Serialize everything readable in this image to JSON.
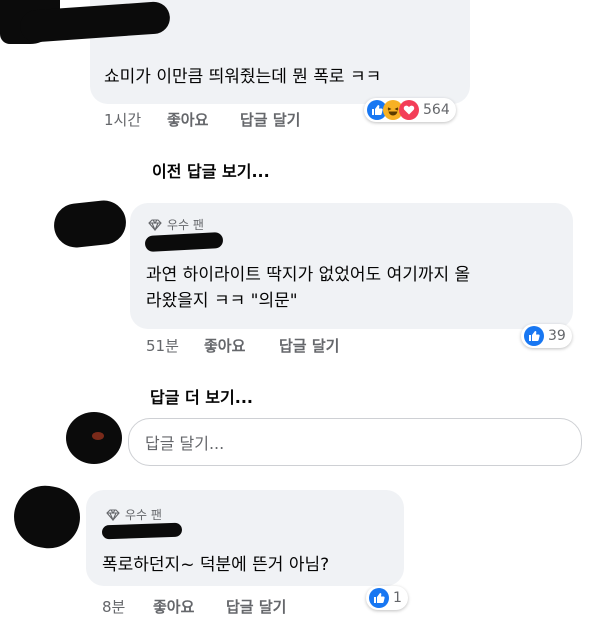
{
  "comments": [
    {
      "text": "쇼미가 이만큼 띄워줬는데 뭔 폭로 ㅋㅋ",
      "time": "1시간",
      "like_label": "좋아요",
      "reply_label": "답글 달기",
      "reaction_count": "564",
      "reactions": [
        "like-icon",
        "haha-icon",
        "love-icon"
      ]
    },
    {
      "badge": "우수 팬",
      "text": "과연 하이라이트 딱지가 없었어도 여기까지 올\n라왔을지 ㅋㅋ \"의문\"",
      "time": "51분",
      "like_label": "좋아요",
      "reply_label": "답글 달기",
      "reaction_count": "39",
      "reactions": [
        "like-icon"
      ]
    },
    {
      "badge": "우수 팬",
      "text": "폭로하던지~ 덕분에 뜬거 아님?",
      "time": "8분",
      "like_label": "좋아요",
      "reply_label": "답글 달기",
      "reaction_count": "1",
      "reactions": [
        "like-icon"
      ]
    }
  ],
  "view_previous_replies": "이전 답글 보기...",
  "view_more_replies": "답글 더 보기...",
  "reply_input": {
    "placeholder": "답글 달기..."
  },
  "colors": {
    "bubble": "#f0f2f5",
    "meta_text": "#65676b",
    "like_blue": "#1877f2",
    "haha_yellow": "#f7b125",
    "love_red": "#f33e58"
  }
}
